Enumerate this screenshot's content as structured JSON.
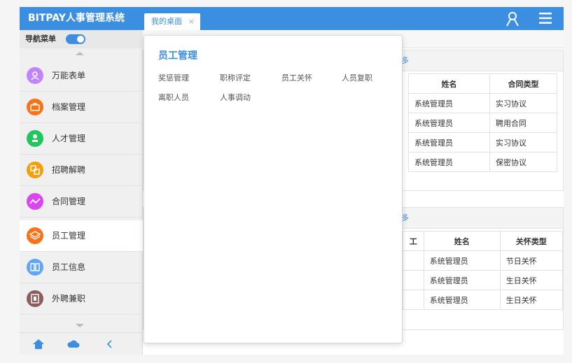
{
  "header": {
    "brand": "BITPAY人事管理系统",
    "tab_label": "我的桌面",
    "tab_close": "×",
    "accent": "#3b8ee0"
  },
  "sidebar": {
    "toggle_label": "导航菜单",
    "items": [
      {
        "label": "万能表单",
        "icon": "user-icon",
        "color": "#c084fc"
      },
      {
        "label": "档案管理",
        "icon": "briefcase-icon",
        "color": "#f97316"
      },
      {
        "label": "人才管理",
        "icon": "talent-icon",
        "color": "#22c55e"
      },
      {
        "label": "招聘解聘",
        "icon": "recruit-icon",
        "color": "#f59e0b"
      },
      {
        "label": "合同管理",
        "icon": "contract-icon",
        "color": "#d946ef"
      },
      {
        "label": "员工管理",
        "icon": "layers-icon",
        "color": "#f97316"
      },
      {
        "label": "员工信息",
        "icon": "book-icon",
        "color": "#60a5fa"
      },
      {
        "label": "外聘兼职",
        "icon": "building-icon",
        "color": "#8b5e5e"
      }
    ],
    "footer": [
      "home-icon",
      "cloud-icon",
      "chevron-left-icon"
    ]
  },
  "dropdown": {
    "title": "员工管理",
    "links": [
      "奖惩管理",
      "职称评定",
      "员工关怀",
      "人员复职",
      "离职人员",
      "人事调动"
    ]
  },
  "contracts_card": {
    "more": "多",
    "columns": [
      "姓名",
      "合同类型"
    ],
    "rows": [
      {
        "name": "系统管理员",
        "type": "实习协议"
      },
      {
        "name": "系统管理员",
        "type": "聘用合同"
      },
      {
        "name": "系统管理员",
        "type": "实习协议"
      },
      {
        "name": "系统管理员",
        "type": "保密协议"
      }
    ]
  },
  "care_card": {
    "more": "多",
    "col_partial": "工",
    "columns": [
      "姓名",
      "关怀类型"
    ],
    "rows": [
      {
        "name": "系统管理员",
        "type": "节日关怀"
      },
      {
        "name": "系统管理员",
        "type": "生日关怀"
      },
      {
        "name": "系统管理员",
        "type": "生日关怀"
      }
    ]
  }
}
